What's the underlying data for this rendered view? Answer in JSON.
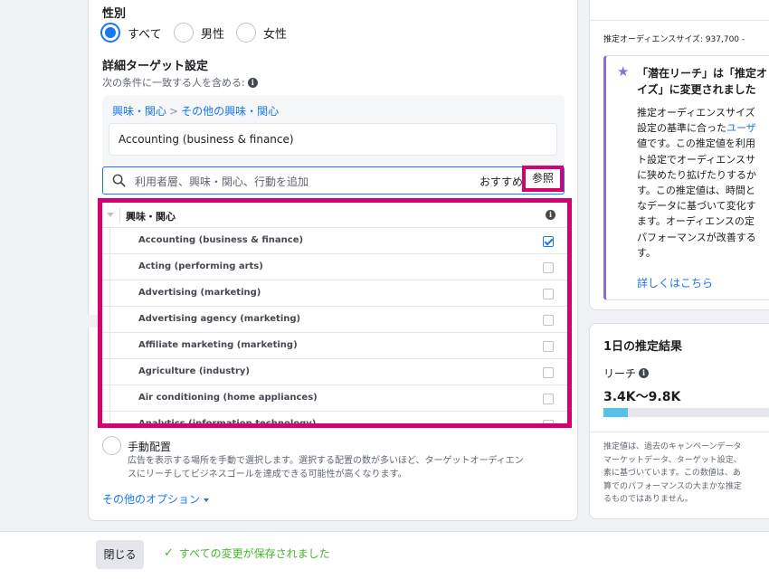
{
  "gender": {
    "title": "性別",
    "options": [
      "すべて",
      "男性",
      "女性"
    ],
    "selected": "すべて"
  },
  "detailed_targeting": {
    "title": "詳細ターゲット設定",
    "subtitle": "次の条件に一致する人を含める:",
    "breadcrumb": [
      "興味・関心",
      "その他の興味・関心"
    ],
    "selected_item": "Accounting (business & finance)",
    "search_placeholder": "利用者層、興味・関心、行動を追加",
    "suggest_label": "おすすめ",
    "browse_label": "参照"
  },
  "dropdown": {
    "category": "興味・関心",
    "items": [
      {
        "label": "Accounting (business & finance)",
        "checked": true
      },
      {
        "label": "Acting (performing arts)",
        "checked": false
      },
      {
        "label": "Advertising (marketing)",
        "checked": false
      },
      {
        "label": "Advertising agency (marketing)",
        "checked": false
      },
      {
        "label": "Affiliate marketing (marketing)",
        "checked": false
      },
      {
        "label": "Agriculture (industry)",
        "checked": false
      },
      {
        "label": "Air conditioning (home appliances)",
        "checked": false
      },
      {
        "label": "Analytics (information technology)",
        "checked": false
      }
    ]
  },
  "placement": {
    "manual_title": "手動配置",
    "manual_desc": [
      "広告を表示する場所を手動で選択します。選択する配置の数が多いほど、ターゲットオーディエン",
      "スにリーチしてビジネスゴールを達成できる可能性が高くなります。"
    ],
    "more_options": "その他のオプション"
  },
  "audience": {
    "size_text": "推定オーディエンスサイズ: 937,700 -",
    "notice_title": [
      "「潜在リーチ」は「推定オ",
      "イズ」に変更されました"
    ],
    "notice_body": [
      "推定オーディエンスサイズ",
      "設定の基準に合った",
      "値です。この推定値を利用",
      "ト設定でオーディエンスサ",
      "に狭めたり拡げたりするか",
      "す。この推定値は、時間と",
      "なデータに基づいて変化す",
      "ます。オーディエンスの定",
      "パフォーマンスが改善する",
      "す。"
    ],
    "notice_body_link": "ユーザ",
    "learn_more": "詳しくはこちら"
  },
  "daily_results": {
    "title": "1日の推定結果",
    "reach_label": "リーチ",
    "reach_value": "3.4K〜9.8K",
    "reach_bar_fraction": 0.14,
    "note": [
      "推定値は、過去のキャンペーンデータ",
      "マーケットデータ、ターゲット設定、",
      "素に基づいています。この数値は、あ",
      "算でのパフォーマンスの大まかな推定",
      "るものではありません。"
    ]
  },
  "footer": {
    "close_label": "閉じる",
    "saved_text": "すべての変更が保存されました"
  },
  "colors": {
    "accent": "#1877f2",
    "highlight": "#d6006f",
    "success": "#42b72a",
    "notice_border": "#8b6fd6",
    "reach_bar": "#56c1ea"
  }
}
